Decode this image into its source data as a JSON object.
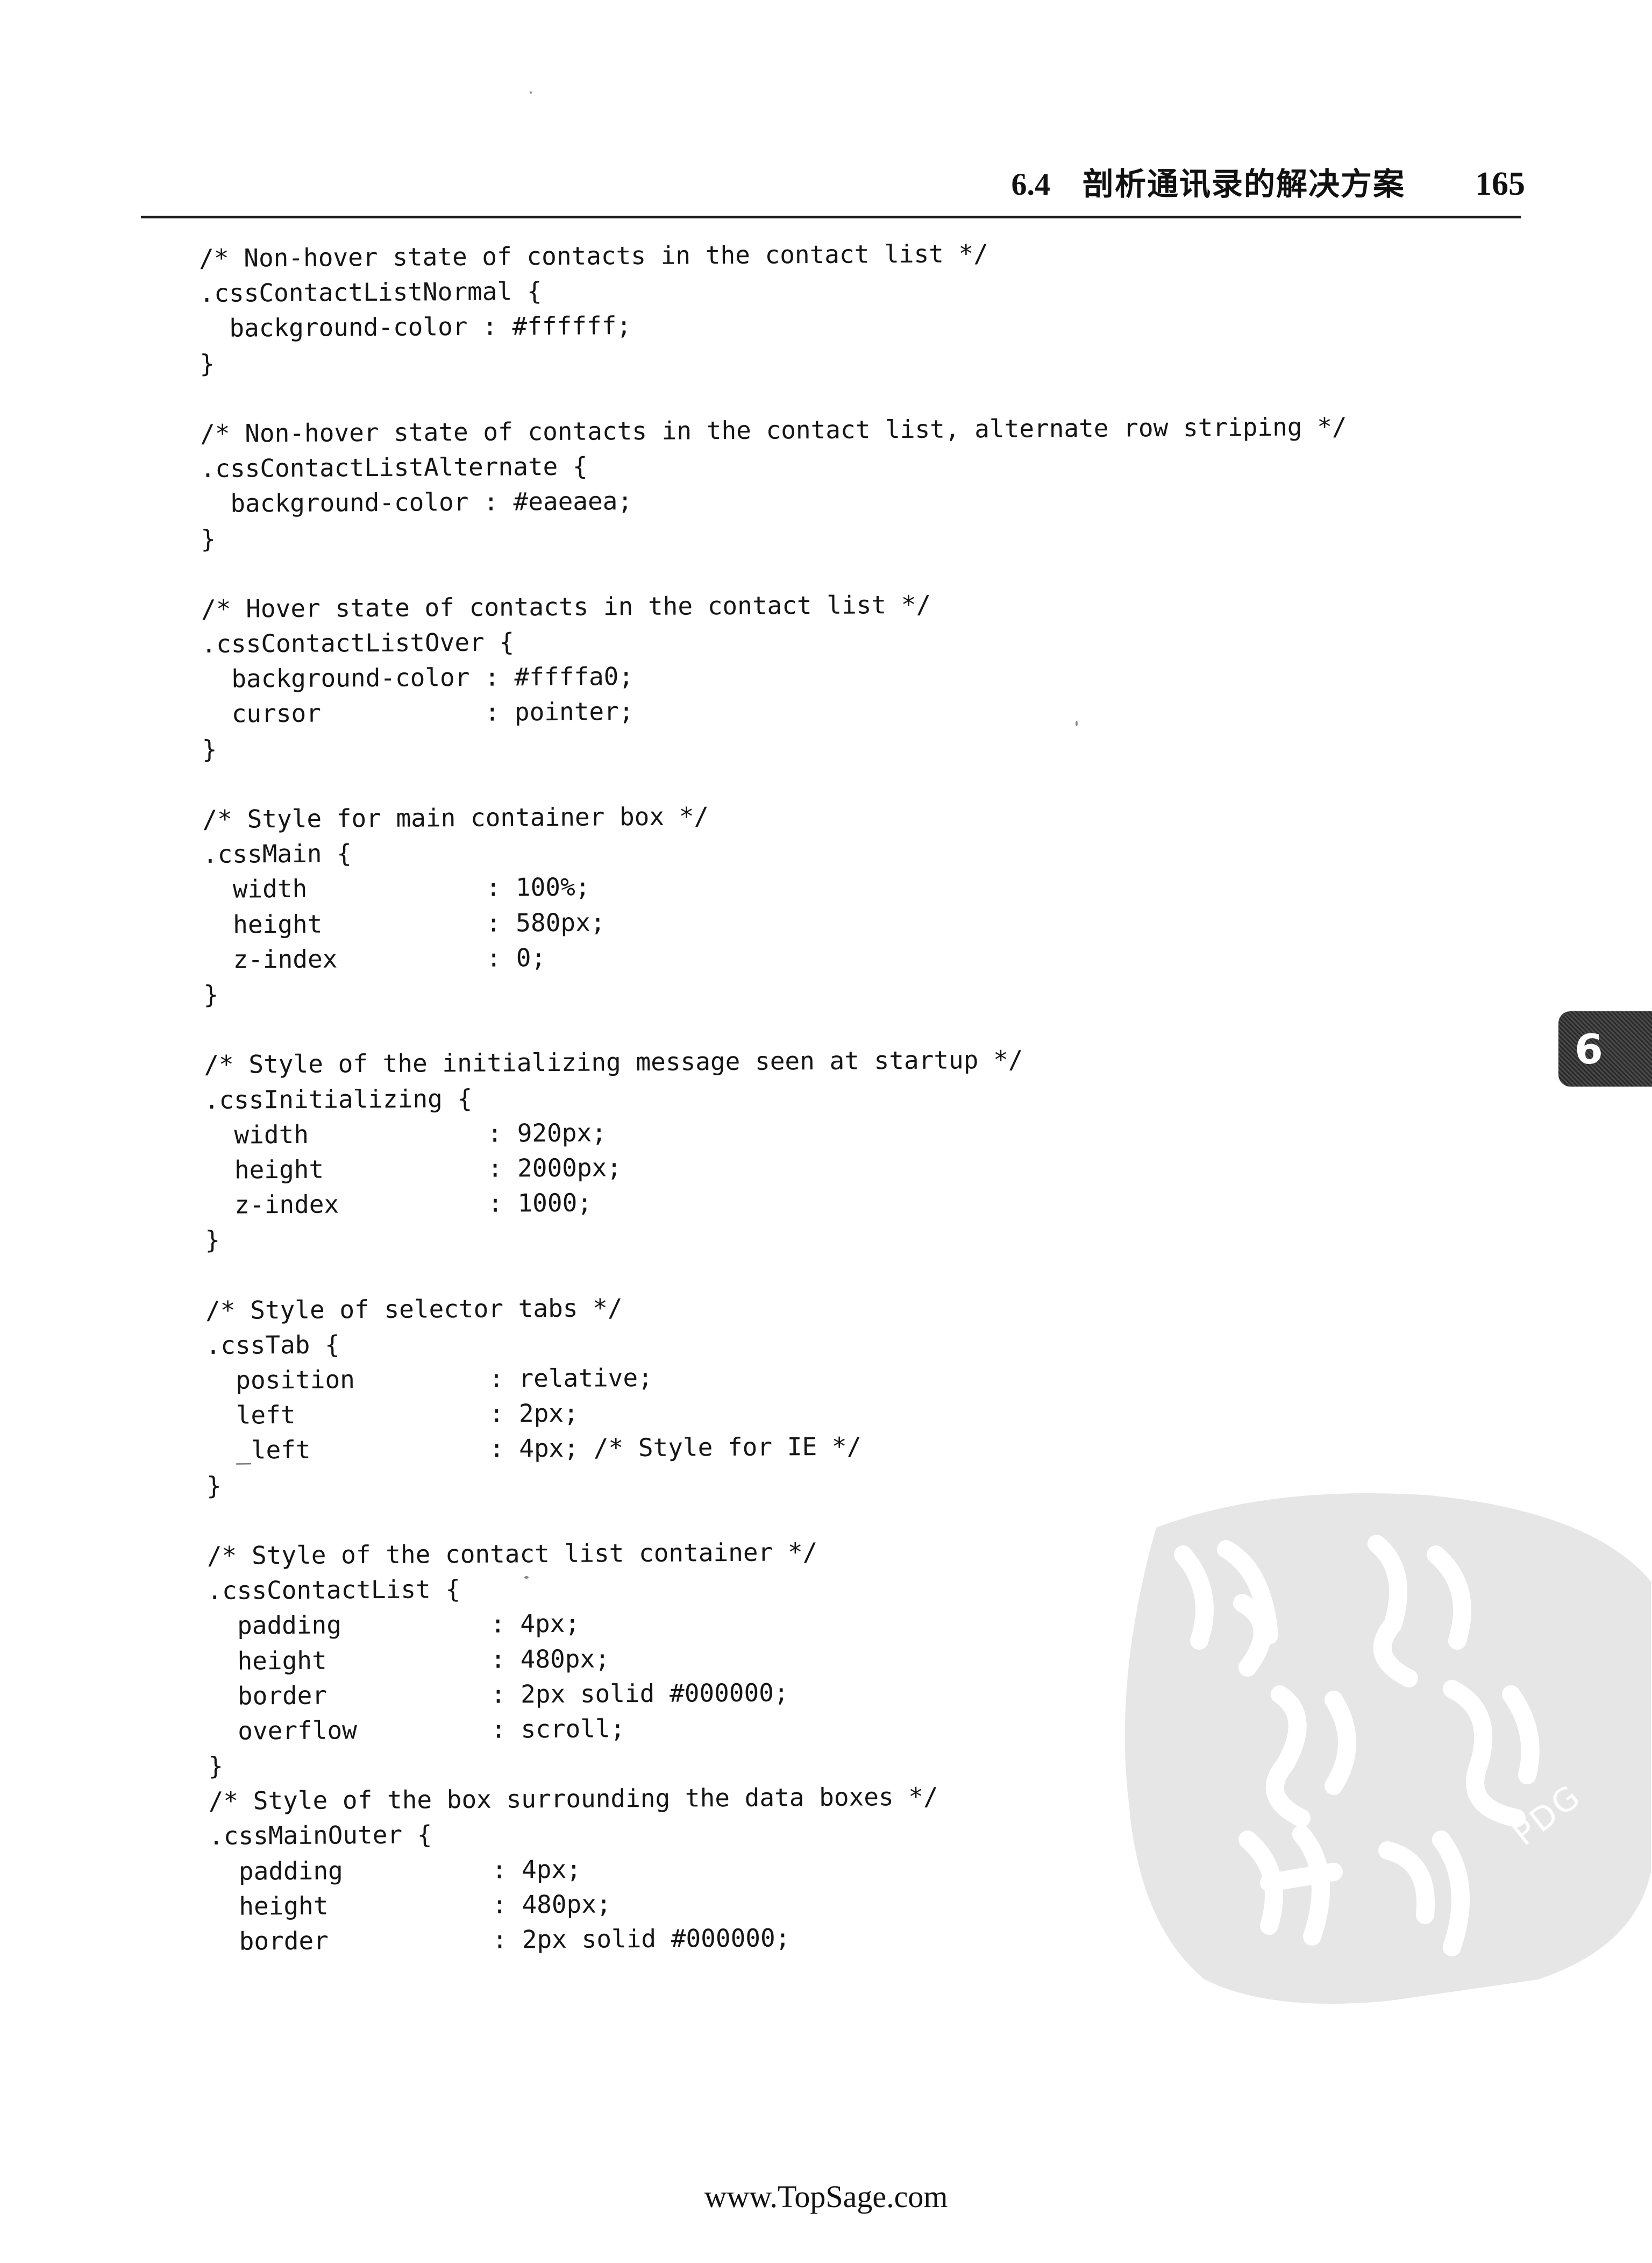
{
  "header": {
    "section_number": "6.4",
    "section_title": "剖析通讯录的解决方案",
    "page_number": "165"
  },
  "code_lines": [
    "/* Non-hover state of contacts in the contact list */",
    ".cssContactListNormal {",
    "  background-color : #ffffff;",
    "}",
    "",
    "/* Non-hover state of contacts in the contact list, alternate row striping */",
    ".cssContactListAlternate {",
    "  background-color : #eaeaea;",
    "}",
    "",
    "/* Hover state of contacts in the contact list */",
    ".cssContactListOver {",
    "  background-color : #ffffa0;",
    "  cursor           : pointer;",
    "}",
    "",
    "/* Style for main container box */",
    ".cssMain {",
    "  width            : 100%;",
    "  height           : 580px;",
    "  z-index          : 0;",
    "}",
    "",
    "/* Style of the initializing message seen at startup */",
    ".cssInitializing {",
    "  width            : 920px;",
    "  height           : 2000px;",
    "  z-index          : 1000;",
    "}",
    "",
    "/* Style of selector tabs */",
    ".cssTab {",
    "  position         : relative;",
    "  left             : 2px;",
    "  _left            : 4px; /* Style for IE */",
    "}",
    "",
    "/* Style of the contact list container */",
    ".cssContactList {",
    "  padding          : 4px;",
    "  height           : 480px;",
    "  border           : 2px solid #000000;",
    "  overflow         : scroll;",
    "}",
    "/* Style of the box surrounding the data boxes */",
    ".cssMainOuter {",
    "  padding          : 4px;",
    "  height           : 480px;",
    "  border           : 2px solid #000000;"
  ],
  "chapter_tab": "6",
  "watermark": {
    "icon": "seal-watermark-icon",
    "text": "PDG"
  },
  "footer": {
    "url": "www.TopSage.com"
  }
}
